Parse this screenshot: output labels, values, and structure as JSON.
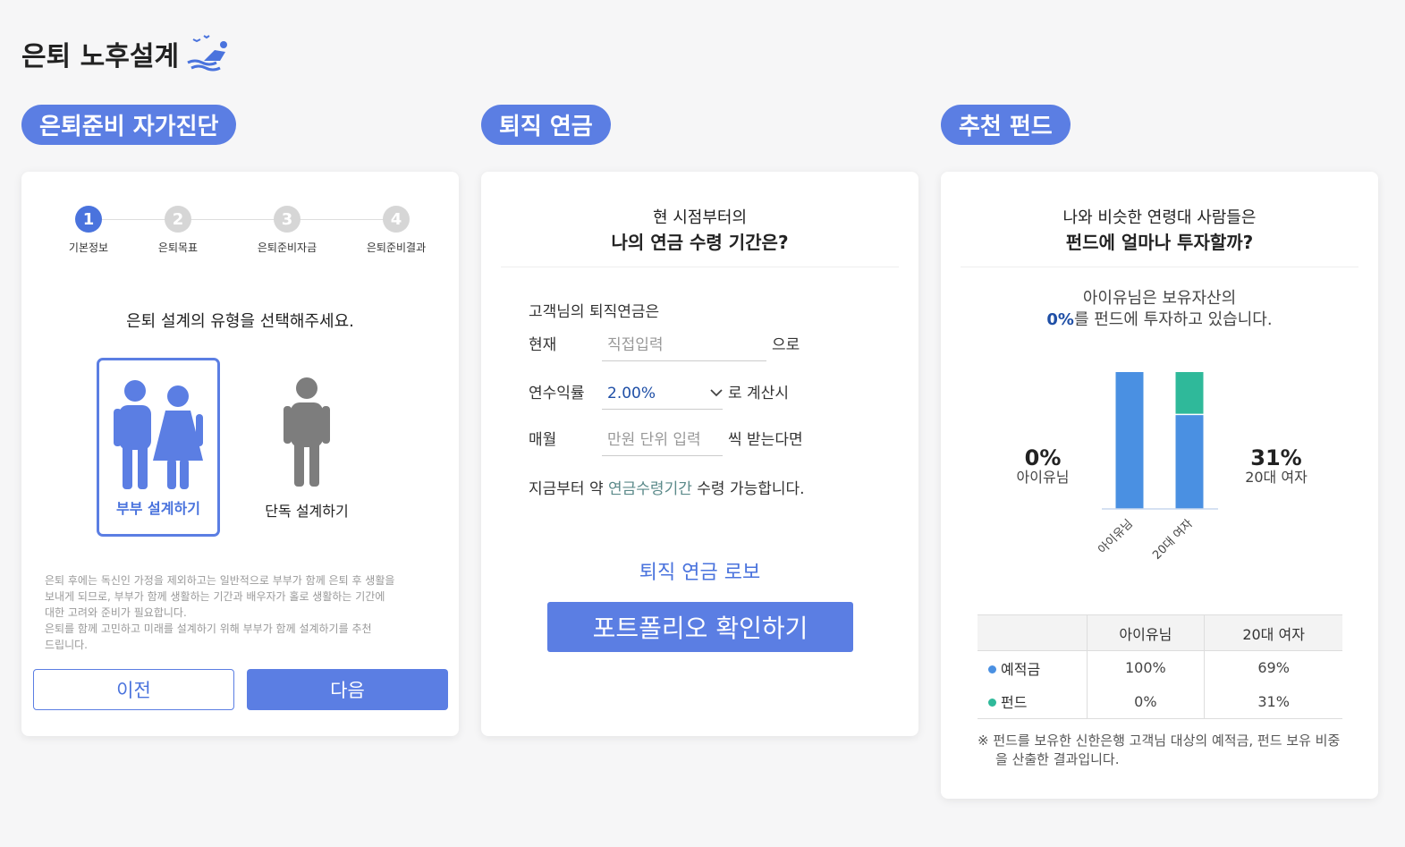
{
  "page": {
    "title": "은퇴 노후설계",
    "title_icon": "beach-chair-icon"
  },
  "sections": [
    {
      "label": "은퇴준비 자가진단"
    },
    {
      "label": "퇴직 연금"
    },
    {
      "label": "추천 펀드"
    }
  ],
  "diagnosis": {
    "steps": [
      {
        "num": "1",
        "label": "기본정보",
        "active": true
      },
      {
        "num": "2",
        "label": "은퇴목표",
        "active": false
      },
      {
        "num": "3",
        "label": "은퇴준비자금",
        "active": false
      },
      {
        "num": "4",
        "label": "은퇴준비결과",
        "active": false
      }
    ],
    "question": "은퇴 설계의 유형을 선택해주세요.",
    "options": [
      {
        "label": "부부 설계하기",
        "icon": "couple-icon",
        "selected": true
      },
      {
        "label": "단독 설계하기",
        "icon": "single-person-icon",
        "selected": false
      }
    ],
    "description_lines": [
      "은퇴 후에는 독신인 가정을 제외하고는 일반적으로 부부가 함께 은퇴 후 생활을",
      "보내게 되므로, 부부가 함께 생활하는 기간과 배우자가 홀로 생활하는 기간에",
      "대한 고려와 준비가 필요합니다.",
      "은퇴를 함께 고민하고 미래를 설계하기 위해 부부가 함께 설계하기를 추천",
      "드립니다."
    ],
    "prev_label": "이전",
    "next_label": "다음"
  },
  "pension": {
    "header_sub": "현 시점부터의",
    "header_main": "나의 연금 수령 기간은?",
    "intro": "고객님의 퇴직연금은",
    "current": {
      "label": "현재",
      "placeholder": "직접입력",
      "suffix": "으로"
    },
    "rate": {
      "label": "연수익률",
      "value": "2.00%",
      "suffix": "로 계산시"
    },
    "monthly": {
      "label": "매월",
      "placeholder": "만원 단위 입력",
      "suffix": "씩 받는다면"
    },
    "result_prefix": "지금부터 약 ",
    "result_highlight": "연금수령기간",
    "result_suffix": " 수령 가능합니다.",
    "robo_label": "퇴직 연금 로보",
    "robo_button": "포트폴리오 확인하기"
  },
  "fund": {
    "header_sub": "나와 비슷한 연령대 사람들은",
    "header_main": "펀드에 얼마나 투자할까?",
    "info_line1": "아이유님은 보유자산의",
    "info_pct": "0%",
    "info_line2": "를 펀드에 투자하고 있습니다.",
    "left_callout": {
      "value": "0%",
      "label": "아이유님"
    },
    "right_callout": {
      "value": "31%",
      "label": "20대 여자"
    },
    "table": {
      "headers": [
        "",
        "아이유님",
        "20대 여자"
      ],
      "rows": [
        {
          "label": "예적금",
          "color": "#4a90e2",
          "values": [
            "100%",
            "69%"
          ]
        },
        {
          "label": "펀드",
          "color": "#2fb99a",
          "values": [
            "0%",
            "31%"
          ]
        }
      ]
    },
    "note": "※ 펀드를 보유한 신한은행 고객님 대상의 예적금, 펀드 보유 비중을 산출한 결과입니다."
  },
  "chart_data": {
    "type": "bar",
    "stacked": true,
    "categories": [
      "아이유님",
      "20대 여자"
    ],
    "series": [
      {
        "name": "예적금",
        "color": "#4a90e2",
        "values": [
          100,
          69
        ]
      },
      {
        "name": "펀드",
        "color": "#2fb99a",
        "values": [
          0,
          31
        ]
      }
    ],
    "ylim": [
      0,
      100
    ],
    "grid": false
  }
}
